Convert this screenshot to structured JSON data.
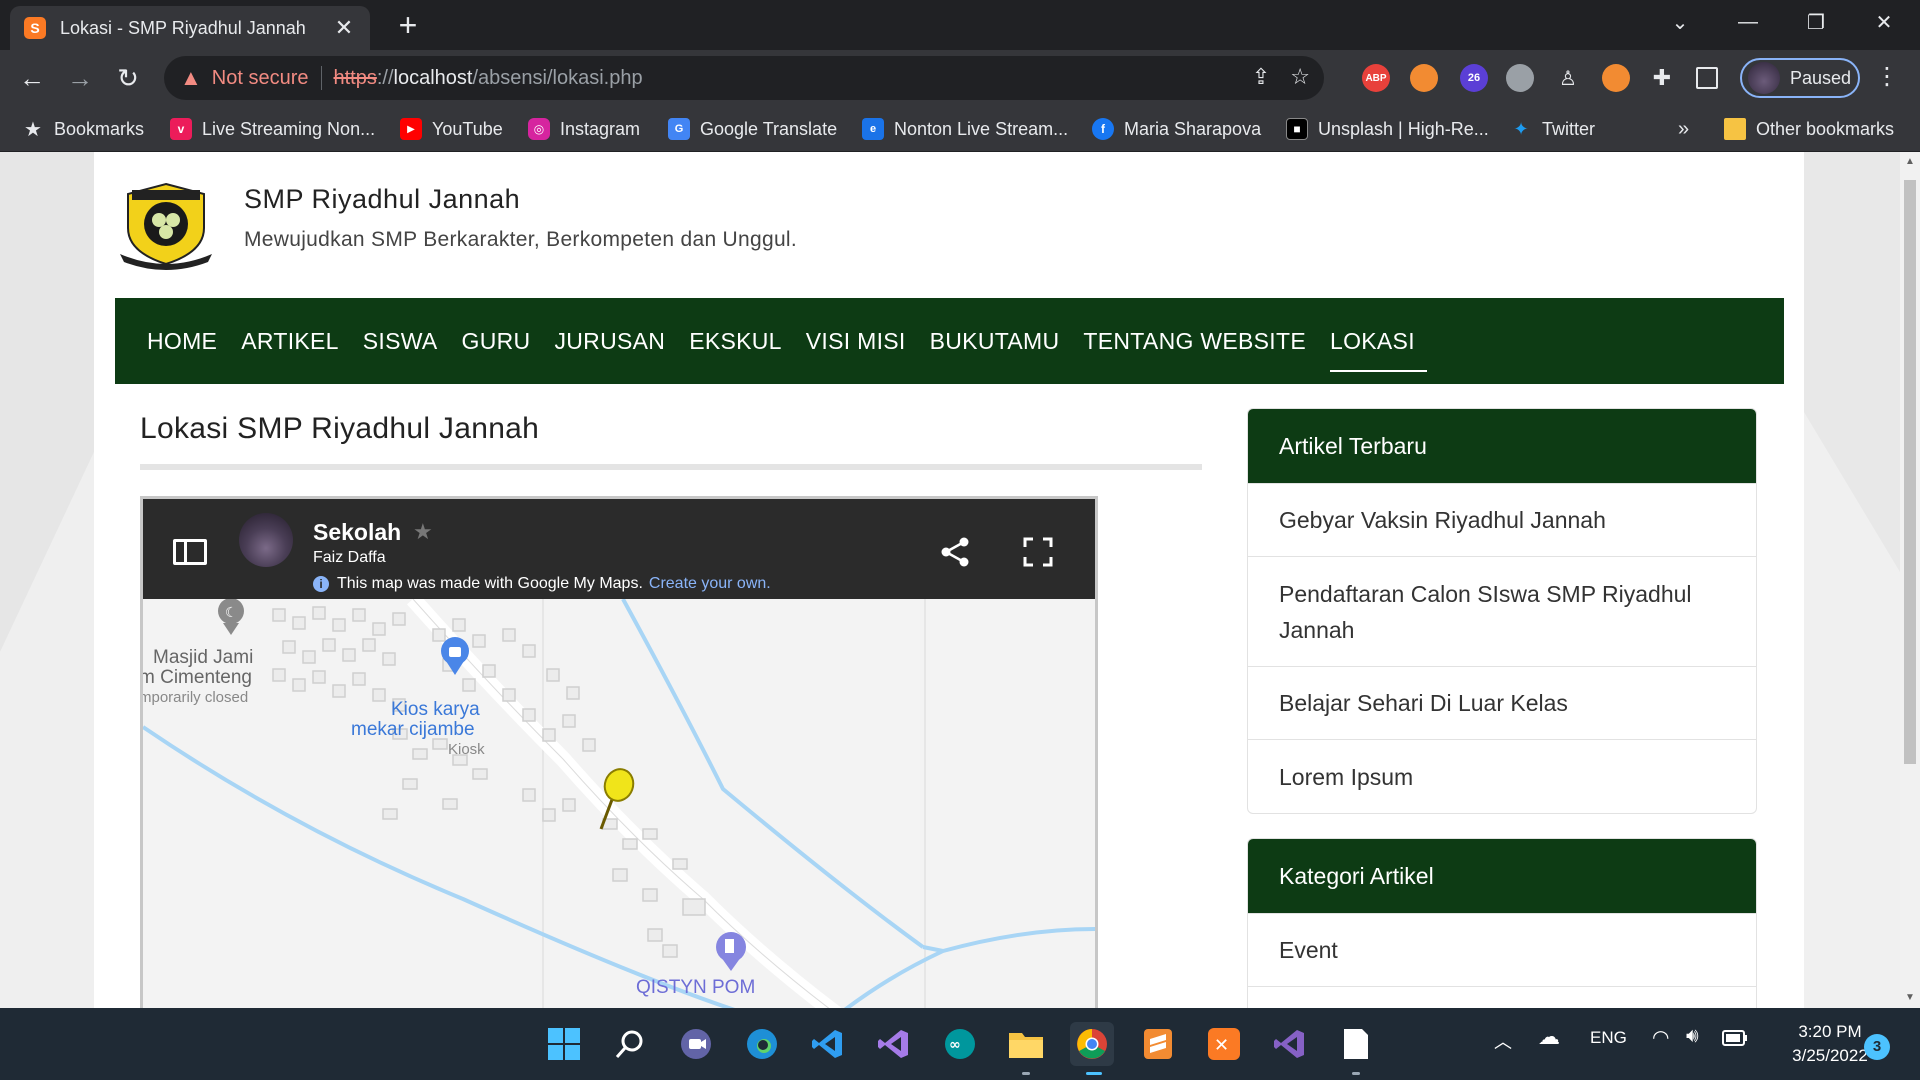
{
  "browser": {
    "tab_title": "Lokasi - SMP Riyadhul Jannah",
    "tab_favicon_text": "S",
    "new_tab": "+",
    "omnibox": {
      "not_secure_label": "Not secure",
      "url_scheme": "https",
      "url_sep": "://",
      "url_host": "localhost",
      "url_path": "/absensi/lokasi.php"
    },
    "extensions": [
      {
        "name": "abp",
        "label": "ABP",
        "color": "#e8413b"
      },
      {
        "name": "extension-2",
        "label": "",
        "color": "#f28b32"
      },
      {
        "name": "extension-badge",
        "label": "26",
        "color": "#5b3fd6"
      },
      {
        "name": "extension-shield",
        "label": "",
        "color": "#9aa0a6"
      }
    ],
    "profile_label": "Paused",
    "bookmarks": [
      {
        "label": "Bookmarks",
        "icon": "star-icon",
        "color": "#e8eaed"
      },
      {
        "label": "Live Streaming Non...",
        "icon": "vidio-icon",
        "color": "#ec1c5a"
      },
      {
        "label": "YouTube",
        "icon": "youtube-icon",
        "color": "#ff0000"
      },
      {
        "label": "Instagram",
        "icon": "instagram-icon",
        "color": "#d6249f"
      },
      {
        "label": "Google Translate",
        "icon": "translate-icon",
        "color": "#4285f4"
      },
      {
        "label": "Nonton Live Stream...",
        "icon": "live-stream-icon",
        "color": "#1a73e8"
      },
      {
        "label": "Maria Sharapova",
        "icon": "facebook-icon",
        "color": "#1877f2"
      },
      {
        "label": "Unsplash | High-Re...",
        "icon": "unsplash-icon",
        "color": "#000000"
      },
      {
        "label": "Twitter",
        "icon": "twitter-icon",
        "color": "#1d9bf0"
      }
    ],
    "bookmarks_overflow": "»",
    "other_bookmarks": "Other bookmarks"
  },
  "site": {
    "title": "SMP Riyadhul Jannah",
    "tagline": "Mewujudkan SMP Berkarakter, Berkompeten dan Unggul.",
    "nav": [
      {
        "label": "HOME",
        "active": false
      },
      {
        "label": "ARTIKEL",
        "active": false
      },
      {
        "label": "SISWA",
        "active": false
      },
      {
        "label": "GURU",
        "active": false
      },
      {
        "label": "JURUSAN",
        "active": false
      },
      {
        "label": "EKSKUL",
        "active": false
      },
      {
        "label": "VISI MISI",
        "active": false
      },
      {
        "label": "BUKUTAMU",
        "active": false
      },
      {
        "label": "TENTANG WEBSITE",
        "active": false
      },
      {
        "label": "LOKASI",
        "active": true
      }
    ],
    "brand_color": "#0d3b14"
  },
  "main": {
    "title": "Lokasi SMP Riyadhul Jannah",
    "map": {
      "title": "Sekolah",
      "author": "Faiz Daffa",
      "note": "This map was made with Google My Maps.",
      "note_link": "Create your own.",
      "poi": {
        "masjid_line1": "Masjid Jami",
        "masjid_line2": "m Cimenteng",
        "masjid_status": "mporarily closed",
        "kiosk_line1": "Kios karya",
        "kiosk_line2": "mekar cijambe",
        "kiosk_type": "Kiosk",
        "pom": "QISTYN POM"
      }
    }
  },
  "sidebar": {
    "recent": {
      "heading": "Artikel Terbaru",
      "items": [
        "Gebyar Vaksin Riyadhul Jannah",
        "Pendaftaran Calon SIswa SMP Riyadhul Jannah",
        "Belajar Sehari Di Luar Kelas",
        "Lorem Ipsum"
      ]
    },
    "categories": {
      "heading": "Kategori Artikel",
      "items": [
        "Event"
      ]
    }
  },
  "taskbar": {
    "apps": [
      {
        "name": "start-button",
        "color": "#4cc2ff"
      },
      {
        "name": "search-icon",
        "color": "#ffffff"
      },
      {
        "name": "teams-icon",
        "color": "#7b83eb"
      },
      {
        "name": "edge-icon",
        "color": "#2fb5e6"
      },
      {
        "name": "vscode-icon",
        "color": "#2f9df0"
      },
      {
        "name": "visual-studio-icon",
        "color": "#a57be8"
      },
      {
        "name": "arduino-icon",
        "color": "#00979d"
      },
      {
        "name": "file-explorer-icon",
        "color": "#f6c343"
      },
      {
        "name": "chrome-icon",
        "color": "#fbbc04"
      },
      {
        "name": "sublime-icon",
        "color": "#f28b32"
      },
      {
        "name": "xampp-icon",
        "color": "#fb7a24"
      },
      {
        "name": "visual-studio-2-icon",
        "color": "#a57be8"
      },
      {
        "name": "notepad-icon",
        "color": "#ffffff"
      }
    ],
    "language": "ENG",
    "time": "3:20 PM",
    "date": "3/25/2022",
    "notifications": "3"
  }
}
